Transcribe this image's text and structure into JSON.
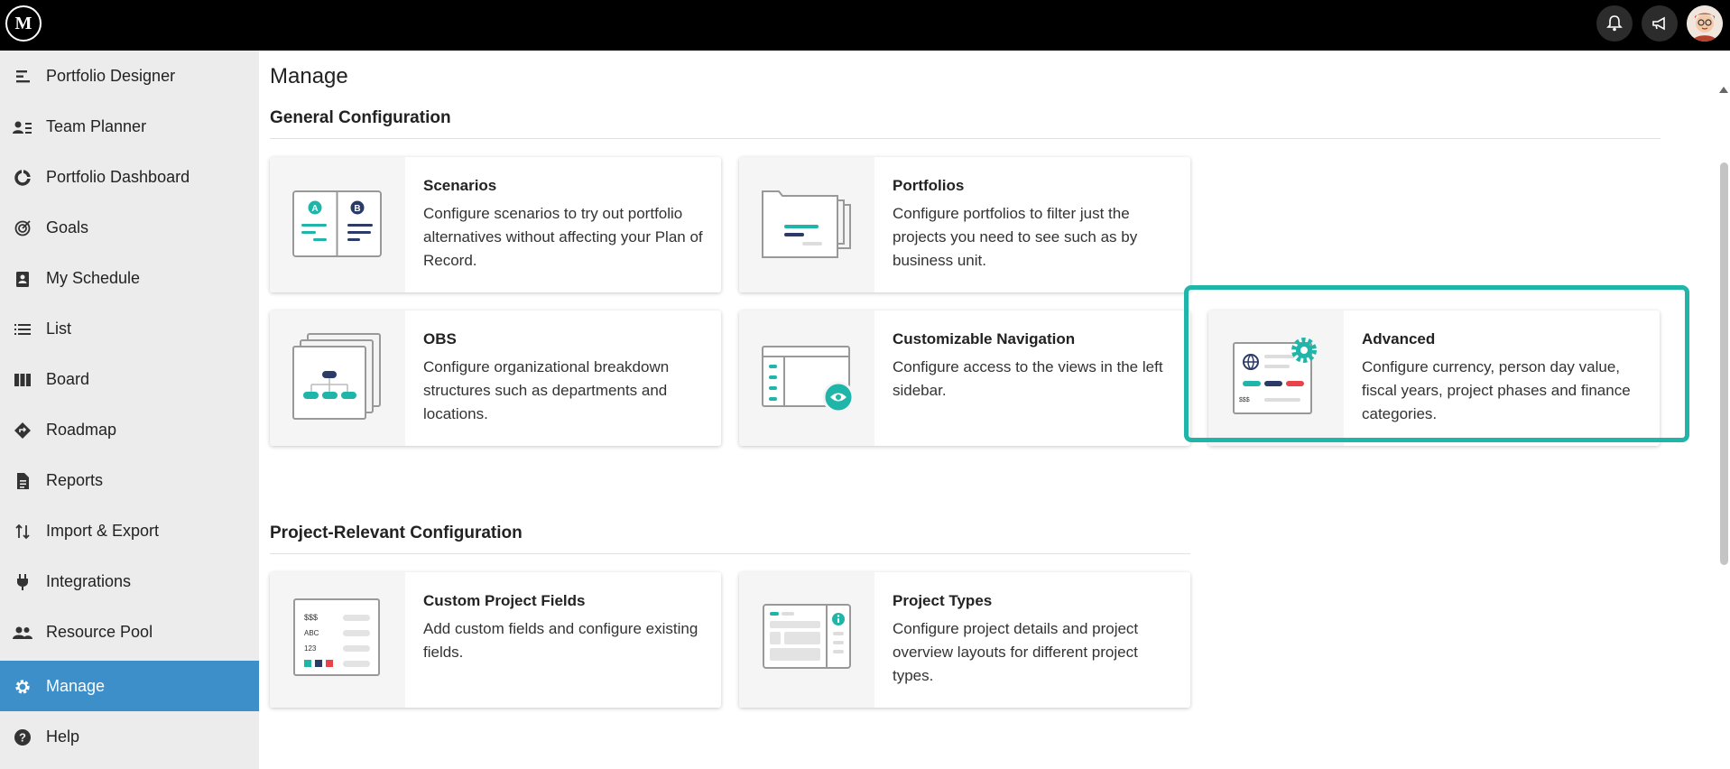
{
  "app": {
    "logo_text": "M"
  },
  "topbar": {
    "icons": [
      "bell-icon",
      "megaphone-icon",
      "user-avatar"
    ]
  },
  "sidebar": {
    "items": [
      {
        "label": "Portfolio Designer",
        "icon": "portfolio-designer-icon"
      },
      {
        "label": "Team Planner",
        "icon": "team-planner-icon"
      },
      {
        "label": "Portfolio Dashboard",
        "icon": "pie-chart-icon"
      },
      {
        "label": "Goals",
        "icon": "target-icon"
      },
      {
        "label": "My Schedule",
        "icon": "schedule-icon"
      },
      {
        "label": "List",
        "icon": "list-icon"
      },
      {
        "label": "Board",
        "icon": "board-icon"
      },
      {
        "label": "Roadmap",
        "icon": "roadmap-icon"
      },
      {
        "label": "Reports",
        "icon": "reports-icon"
      },
      {
        "label": "Import & Export",
        "icon": "import-export-icon"
      },
      {
        "label": "Integrations",
        "icon": "plug-icon"
      },
      {
        "label": "Resource Pool",
        "icon": "people-icon"
      },
      {
        "label": "Manage",
        "icon": "gear-icon",
        "active": true
      },
      {
        "label": "Help",
        "icon": "help-icon"
      }
    ]
  },
  "main": {
    "title": "Manage",
    "sections": [
      {
        "title": "General Configuration",
        "cards": [
          {
            "title": "Scenarios",
            "description": "Configure scenarios to try out portfolio alternatives without affecting your Plan of Record."
          },
          {
            "title": "Portfolios",
            "description": "Configure portfolios to filter just the projects you need to see such as by business unit."
          },
          {
            "title": "OBS",
            "description": "Configure organizational breakdown structures such as departments and locations."
          },
          {
            "title": "Customizable Navigation",
            "description": "Configure access to the views in the left sidebar."
          },
          {
            "title": "Advanced",
            "description": "Configure currency, person day value, fiscal years, project phases and finance categories."
          }
        ]
      },
      {
        "title": "Project-Relevant Configuration",
        "cards": [
          {
            "title": "Custom Project Fields",
            "description": "Add custom fields and configure existing fields."
          },
          {
            "title": "Project Types",
            "description": "Configure project details and project overview layouts for different project types."
          }
        ]
      }
    ]
  },
  "thumbs": {
    "scenario_a": "A",
    "scenario_b": "B",
    "fields_currency": "$$$",
    "fields_text": "ABC",
    "fields_number": "123",
    "advanced_currency": "$$$"
  },
  "colors": {
    "accent": "#1fb5a9",
    "active_nav": "#3d8fc9",
    "navy": "#2b3a67",
    "red": "#e8434b"
  }
}
